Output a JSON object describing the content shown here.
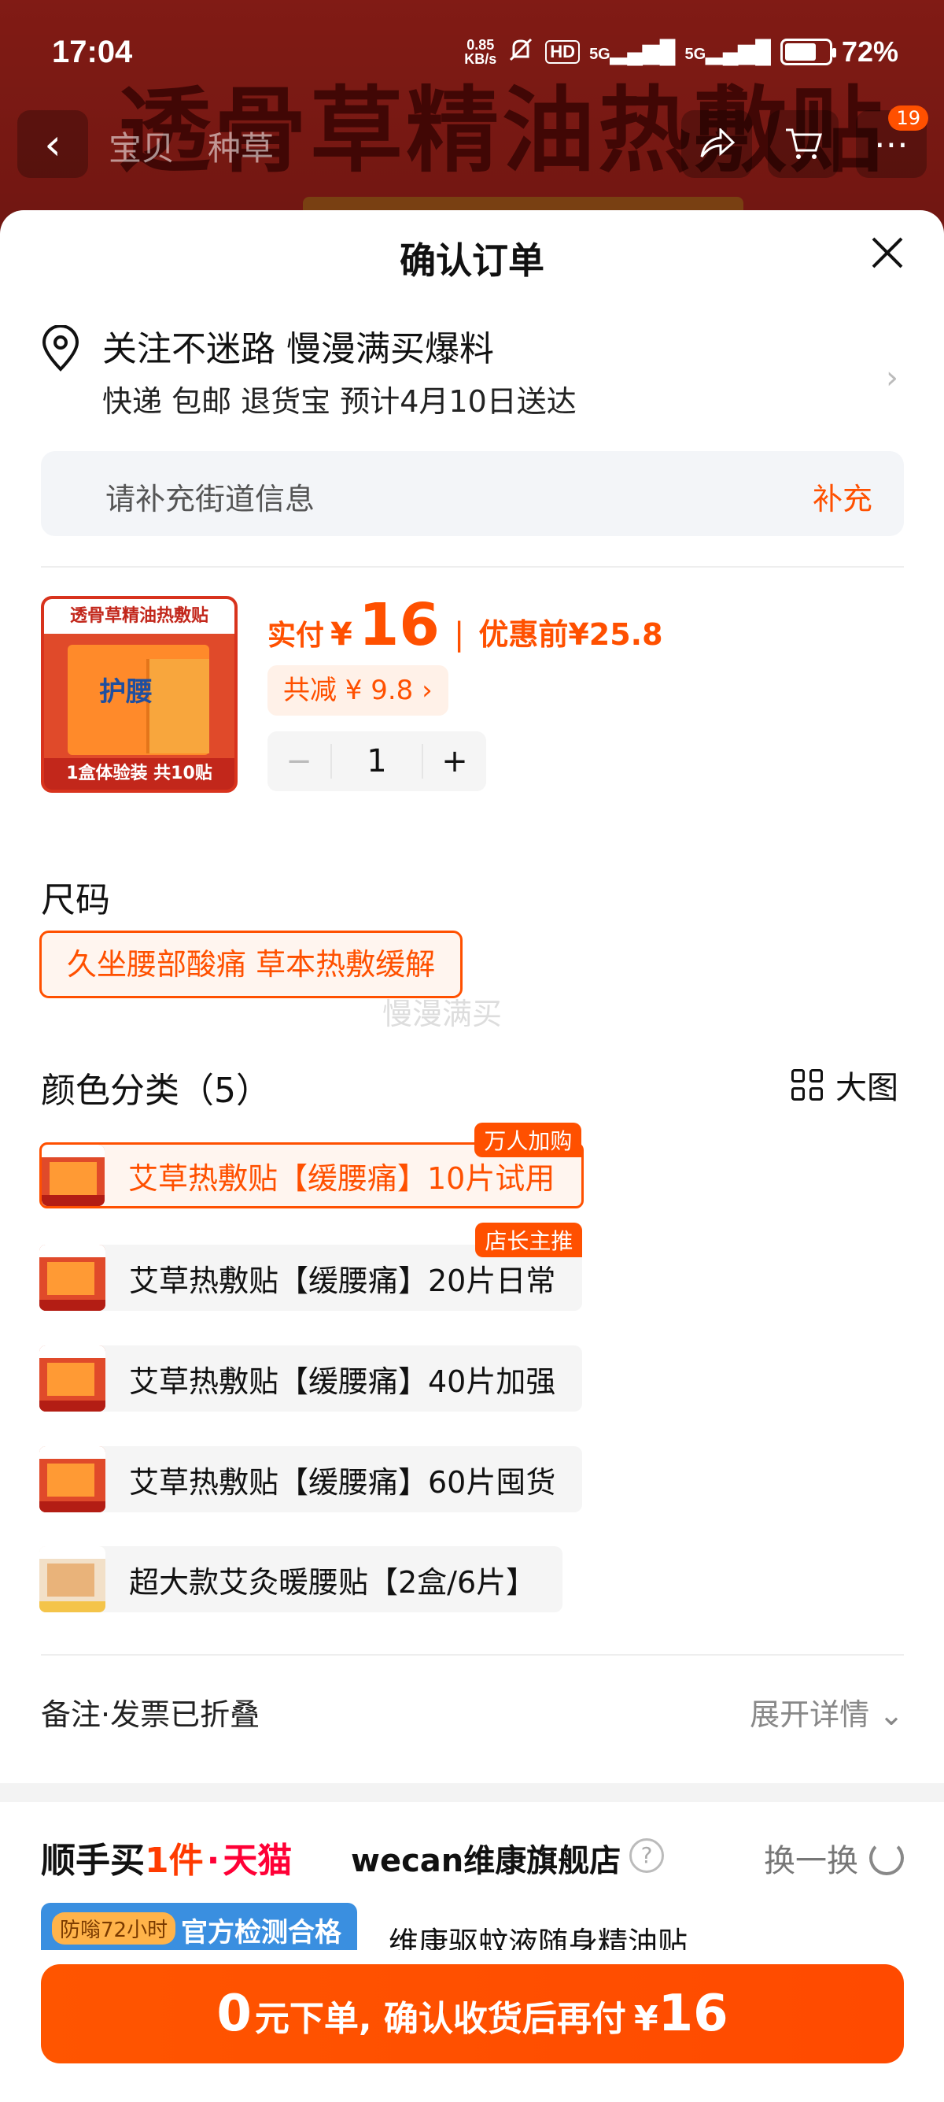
{
  "status_bar": {
    "time": "17:04",
    "net_speed_value": "0.85",
    "net_speed_unit": "KB/s",
    "hd": "HD",
    "signal1": "5G",
    "signal2": "5G",
    "battery_percent": "72%",
    "battery_level": 0.72
  },
  "background": {
    "banner_text": "透骨草精油热敷贴",
    "tabs": [
      "宝贝",
      "种草"
    ],
    "cart_badge": "19"
  },
  "sheet": {
    "title": "确认订单",
    "address": {
      "line1": "关注不迷路 慢漫满买爆料",
      "line2": "快递 包邮 退货宝 预计4月10日送达",
      "street_hint": "请补充街道信息",
      "street_action": "补充"
    },
    "product": {
      "image_top_text": "透骨草精油热敷贴",
      "image_label": "护腰",
      "image_bottom_text": "1盒体验装 共10贴",
      "pay_label": "实付",
      "currency": "¥",
      "pay_amount": "16",
      "before_label": "优惠前",
      "before_amount": "¥25.8",
      "savings_text": "共减 ¥ 9.8 ›",
      "quantity": "1",
      "minus": "−",
      "plus": "+"
    },
    "size": {
      "label": "尺码",
      "option": "久坐腰部酸痛 草本热敷缓解"
    },
    "watermark": "慢漫满买",
    "colors": {
      "label": "颜色分类（5）",
      "big_image_label": "大图",
      "options": [
        {
          "label": "艾草热敷贴【缓腰痛】10片试用",
          "tag": "万人加购",
          "selected": true
        },
        {
          "label": "艾草热敷贴【缓腰痛】20片日常",
          "tag": "店长主推",
          "selected": false
        },
        {
          "label": "艾草热敷贴【缓腰痛】40片加强",
          "tag": "",
          "selected": false
        },
        {
          "label": "艾草热敷贴【缓腰痛】60片囤货",
          "tag": "",
          "selected": false
        },
        {
          "label": "超大款艾灸暖腰贴【2盒/6片】",
          "tag": "",
          "selected": false
        }
      ]
    },
    "notes": {
      "left": "备注·发票已折叠",
      "right": "展开详情 ⌄"
    },
    "addon": {
      "brand_prefix": "顺手买",
      "brand_num": "1件",
      "dot": "·",
      "tmall": "天猫",
      "store": "wecan维康旗舰店",
      "help": "?",
      "swap_label": "换一换",
      "badge_pill": "防嗡72小时",
      "badge_text": "官方检测合格",
      "item_name": "维康驱蚊液随身精油贴"
    },
    "cta": {
      "zero": "0",
      "middle": "元下单, 确认收货后再付",
      "currency": "¥",
      "amount": "16"
    }
  },
  "colors": {
    "accent": "#ff5000",
    "background_red": "#b3261e"
  }
}
